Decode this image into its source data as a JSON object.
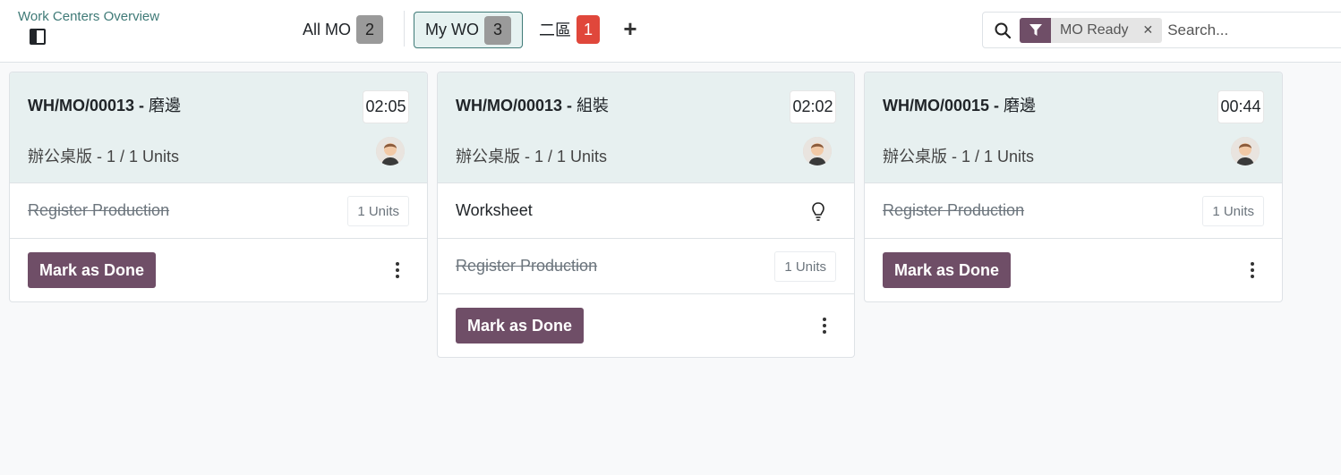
{
  "breadcrumb": {
    "title": "Work Centers Overview"
  },
  "tabs": [
    {
      "label": "All MO",
      "count": "2"
    },
    {
      "label": "My WO",
      "count": "3"
    },
    {
      "label": "二區",
      "count": "1"
    }
  ],
  "search": {
    "facet_label": "MO Ready",
    "placeholder": "Search..."
  },
  "colors": {
    "accent": "#6f4e67",
    "teal": "#3f7a77",
    "card_header": "#e7f0f0",
    "alert": "#e0473b"
  },
  "cards": [
    {
      "title_code": "WH/MO/00013 - ",
      "title_op": "磨邊",
      "timer": "02:05",
      "product": "辦公桌版 - 1 / 1 Units",
      "rows": [
        {
          "label": "Register Production",
          "badge": "1 Units"
        }
      ],
      "action": "Mark as Done"
    },
    {
      "title_code": "WH/MO/00013 - ",
      "title_op": "組裝",
      "timer": "02:02",
      "product": "辦公桌版 - 1 / 1 Units",
      "rows": [
        {
          "label": "Worksheet",
          "icon": "lightbulb-icon"
        },
        {
          "label": "Register Production",
          "badge": "1 Units"
        }
      ],
      "action": "Mark as Done"
    },
    {
      "title_code": "WH/MO/00015 - ",
      "title_op": "磨邊",
      "timer": "00:44",
      "product": "辦公桌版 - 1 / 1 Units",
      "rows": [
        {
          "label": "Register Production",
          "badge": "1 Units"
        }
      ],
      "action": "Mark as Done"
    }
  ]
}
